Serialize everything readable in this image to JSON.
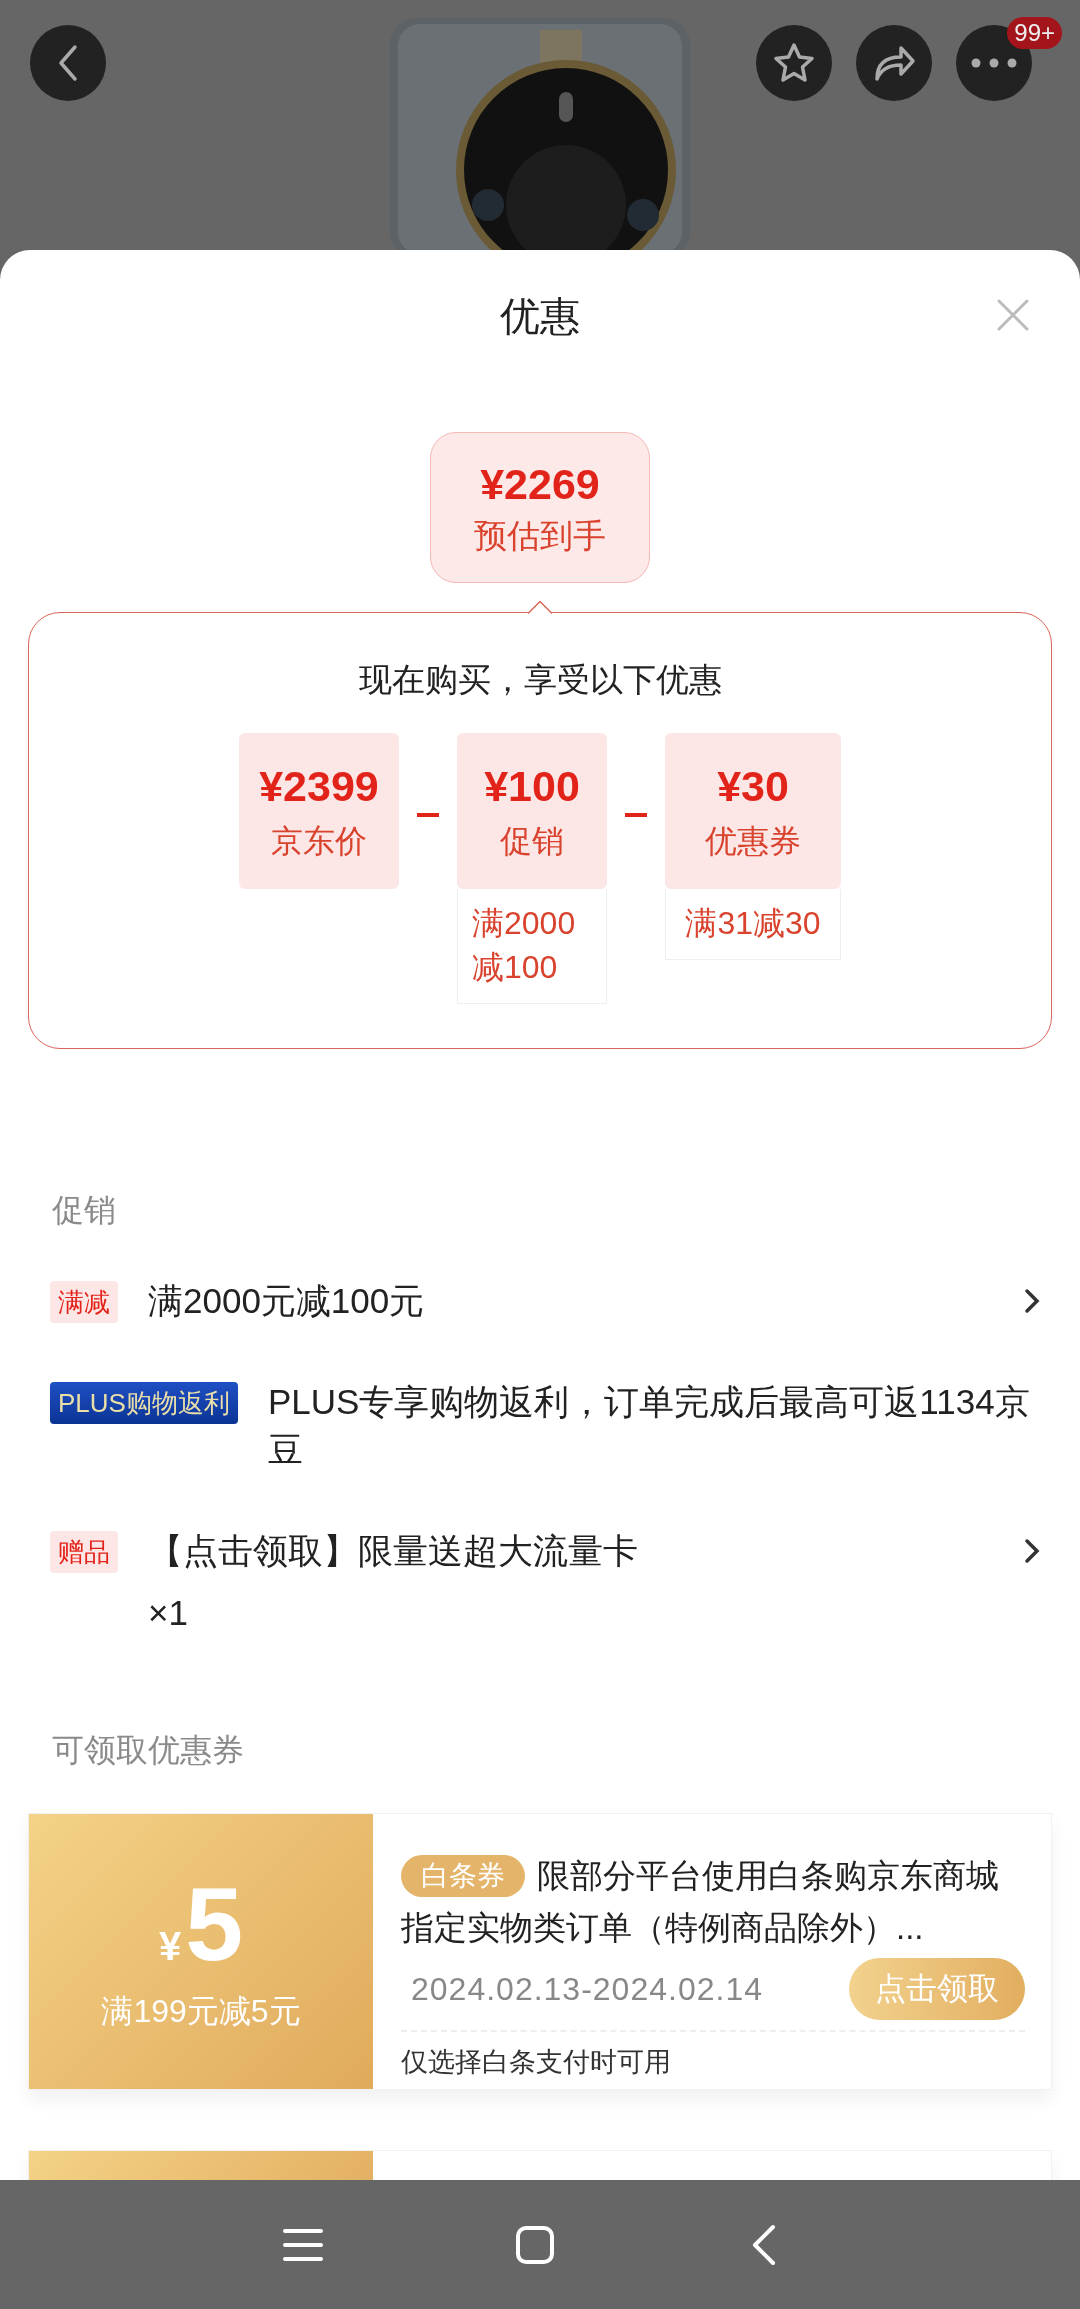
{
  "top_bar": {
    "badge": "99+"
  },
  "sheet": {
    "title": "优惠"
  },
  "estimate": {
    "price": "¥2269",
    "label": "预估到手"
  },
  "breakdown": {
    "heading": "现在购买，享受以下优惠",
    "items": [
      {
        "price": "¥2399",
        "label": "京东价"
      },
      {
        "price": "¥100",
        "label": "促销",
        "note": "满2000减100"
      },
      {
        "price": "¥30",
        "label": "优惠券",
        "note": "满31减30"
      }
    ]
  },
  "promotions": {
    "heading": "促销",
    "items": [
      {
        "kind": "red",
        "tag": "满减",
        "text": "满2000元减100元",
        "has_link": true
      },
      {
        "kind": "plus",
        "tag": "PLUS购物返利",
        "text": "PLUS专享购物返利，订单完成后最高可返1134京豆",
        "has_link": false
      },
      {
        "kind": "red",
        "tag": "赠品",
        "text": "【点击领取】限量送超大流量卡",
        "quantity": "×1",
        "has_link": true
      }
    ]
  },
  "coupons": {
    "heading": "可领取优惠券",
    "items": [
      {
        "kind": "full",
        "currency": "¥",
        "amount": "5",
        "condition": "满199元减5元",
        "tag": "白条券",
        "description": "限部分平台使用白条购京东商城指定实物类订单（特例商品除外）...",
        "validity": "2024.02.13-2024.02.14",
        "button": "点击领取",
        "note": "仅选择白条支付时可用"
      },
      {
        "kind": "partial"
      }
    ]
  }
}
